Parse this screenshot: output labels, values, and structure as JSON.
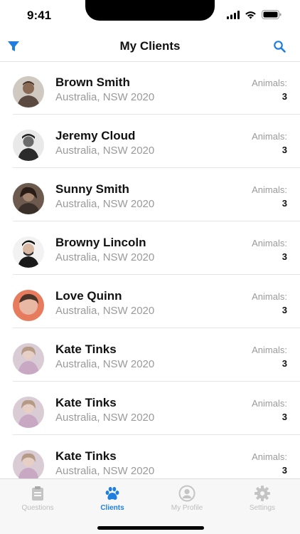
{
  "status_bar": {
    "time": "9:41"
  },
  "nav": {
    "title": "My Clients",
    "filter_icon": "filter-icon",
    "search_icon": "search-icon"
  },
  "clients": [
    {
      "name": "Brown Smith",
      "location": "Australia, NSW 2020",
      "animals_label": "Animals:",
      "animals_count": "3"
    },
    {
      "name": "Jeremy Cloud",
      "location": "Australia, NSW 2020",
      "animals_label": "Animals:",
      "animals_count": "3"
    },
    {
      "name": "Sunny Smith",
      "location": "Australia, NSW 2020",
      "animals_label": "Animals:",
      "animals_count": "3"
    },
    {
      "name": "Browny Lincoln",
      "location": "Australia, NSW 2020",
      "animals_label": "Animals:",
      "animals_count": "3"
    },
    {
      "name": "Love Quinn",
      "location": "Australia, NSW 2020",
      "animals_label": "Animals:",
      "animals_count": "3"
    },
    {
      "name": "Kate Tinks",
      "location": "Australia, NSW 2020",
      "animals_label": "Animals:",
      "animals_count": "3"
    },
    {
      "name": "Kate Tinks",
      "location": "Australia, NSW 2020",
      "animals_label": "Animals:",
      "animals_count": "3"
    },
    {
      "name": "Kate Tinks",
      "location": "Australia, NSW 2020",
      "animals_label": "Animals:",
      "animals_count": "3"
    }
  ],
  "tabs": [
    {
      "label": "Questions",
      "icon": "clipboard-icon",
      "active": false
    },
    {
      "label": "Clients",
      "icon": "paw-icon",
      "active": true
    },
    {
      "label": "My Profile",
      "icon": "profile-icon",
      "active": false
    },
    {
      "label": "Settings",
      "icon": "gear-icon",
      "active": false
    }
  ],
  "colors": {
    "accent": "#1f7fe0",
    "inactive_tab": "#bdbdbd",
    "secondary_text": "#9a9a9a"
  }
}
